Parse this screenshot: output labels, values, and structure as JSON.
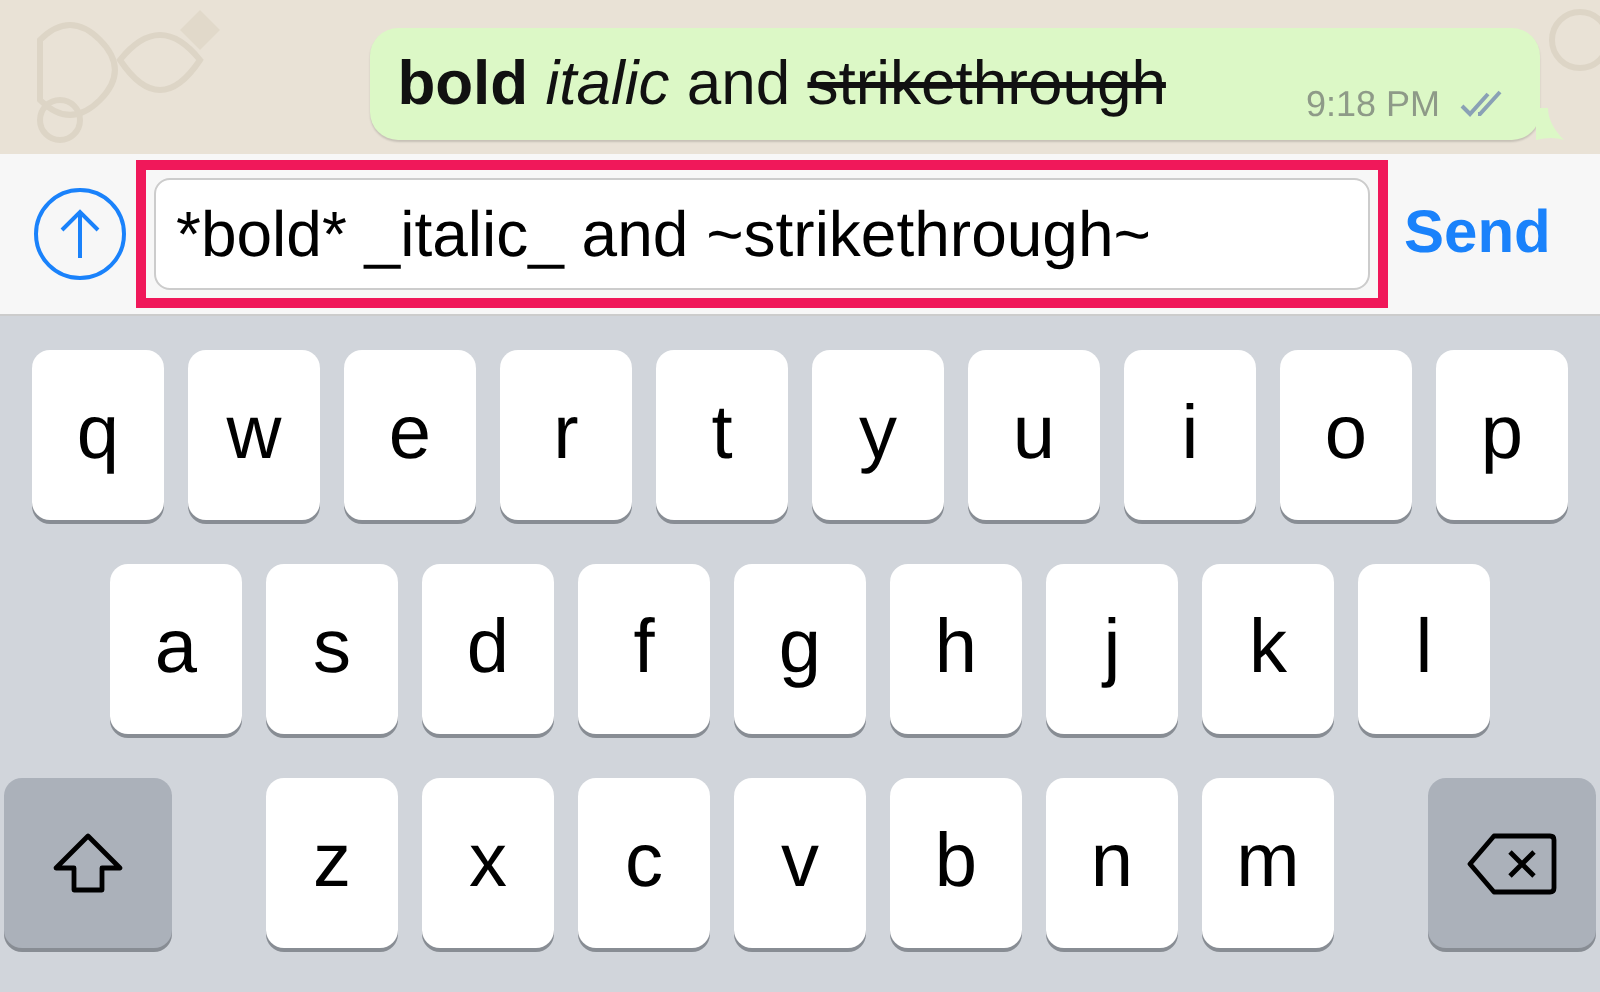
{
  "message": {
    "segments": [
      {
        "text": "bold",
        "kind": "bold"
      },
      {
        "text": "italic",
        "kind": "italic"
      },
      {
        "text": "and",
        "kind": "plain"
      },
      {
        "text": "strikethrough",
        "kind": "strike"
      }
    ],
    "time": "9:18 PM",
    "read": true
  },
  "composer": {
    "value": "*bold* _italic_ and ~strikethrough~",
    "highlighted": true,
    "send": "Send"
  },
  "keyboard": {
    "rows": [
      [
        {
          "kind": "letter",
          "label": "q"
        },
        {
          "kind": "letter",
          "label": "w"
        },
        {
          "kind": "letter",
          "label": "e"
        },
        {
          "kind": "letter",
          "label": "r"
        },
        {
          "kind": "letter",
          "label": "t"
        },
        {
          "kind": "letter",
          "label": "y"
        },
        {
          "kind": "letter",
          "label": "u"
        },
        {
          "kind": "letter",
          "label": "i"
        },
        {
          "kind": "letter",
          "label": "o"
        },
        {
          "kind": "letter",
          "label": "p"
        }
      ],
      [
        {
          "kind": "letter",
          "label": "a"
        },
        {
          "kind": "letter",
          "label": "s"
        },
        {
          "kind": "letter",
          "label": "d"
        },
        {
          "kind": "letter",
          "label": "f"
        },
        {
          "kind": "letter",
          "label": "g"
        },
        {
          "kind": "letter",
          "label": "h"
        },
        {
          "kind": "letter",
          "label": "j"
        },
        {
          "kind": "letter",
          "label": "k"
        },
        {
          "kind": "letter",
          "label": "l"
        }
      ],
      [
        {
          "kind": "shift"
        },
        {
          "kind": "letter",
          "label": "z"
        },
        {
          "kind": "letter",
          "label": "x"
        },
        {
          "kind": "letter",
          "label": "c"
        },
        {
          "kind": "letter",
          "label": "v"
        },
        {
          "kind": "letter",
          "label": "b"
        },
        {
          "kind": "letter",
          "label": "n"
        },
        {
          "kind": "letter",
          "label": "m"
        },
        {
          "kind": "delete"
        }
      ]
    ]
  }
}
